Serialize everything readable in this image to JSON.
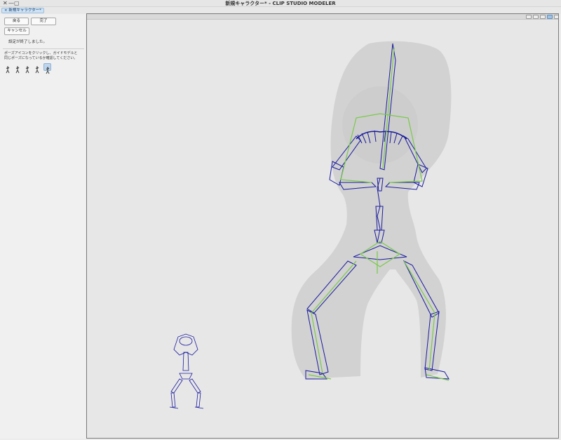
{
  "window": {
    "title": "新規キャラクター* - CLIP STUDIO MODELER",
    "close_glyph": "✕",
    "minimize_glyph": "—",
    "maximize_glyph": "▢"
  },
  "tab": {
    "label": "新規キャラクター*",
    "close_glyph": "×"
  },
  "panel": {
    "back_label": "戻る",
    "done_label": "完了",
    "cancel_label": "キャンセル",
    "status_text": "設定が終了しました。",
    "instruction_line1": "ポーズアイコンをクリックし、ガイドモデルと",
    "instruction_line2": "同じポーズになっているか確認してください。",
    "pose_icons": [
      "pose-1-icon",
      "pose-2-icon",
      "pose-3-icon",
      "pose-4-icon",
      "pose-5-icon"
    ],
    "active_pose_index": 4
  },
  "viewport": {
    "toolbar_icons": [
      "view-grid-icon",
      "view-layout-icon",
      "view-toggle-icon",
      "view-bone-icon",
      "view-fit-icon",
      "view-reset-icon"
    ],
    "active_toolbar_index": 3
  },
  "colors": {
    "bone_blue": "#1a1a9e",
    "bone_green": "#7ac94a",
    "silhouette": "#d2d2d2",
    "viewport_bg": "#e7e7e7",
    "tab_active": "#cde2f5"
  }
}
